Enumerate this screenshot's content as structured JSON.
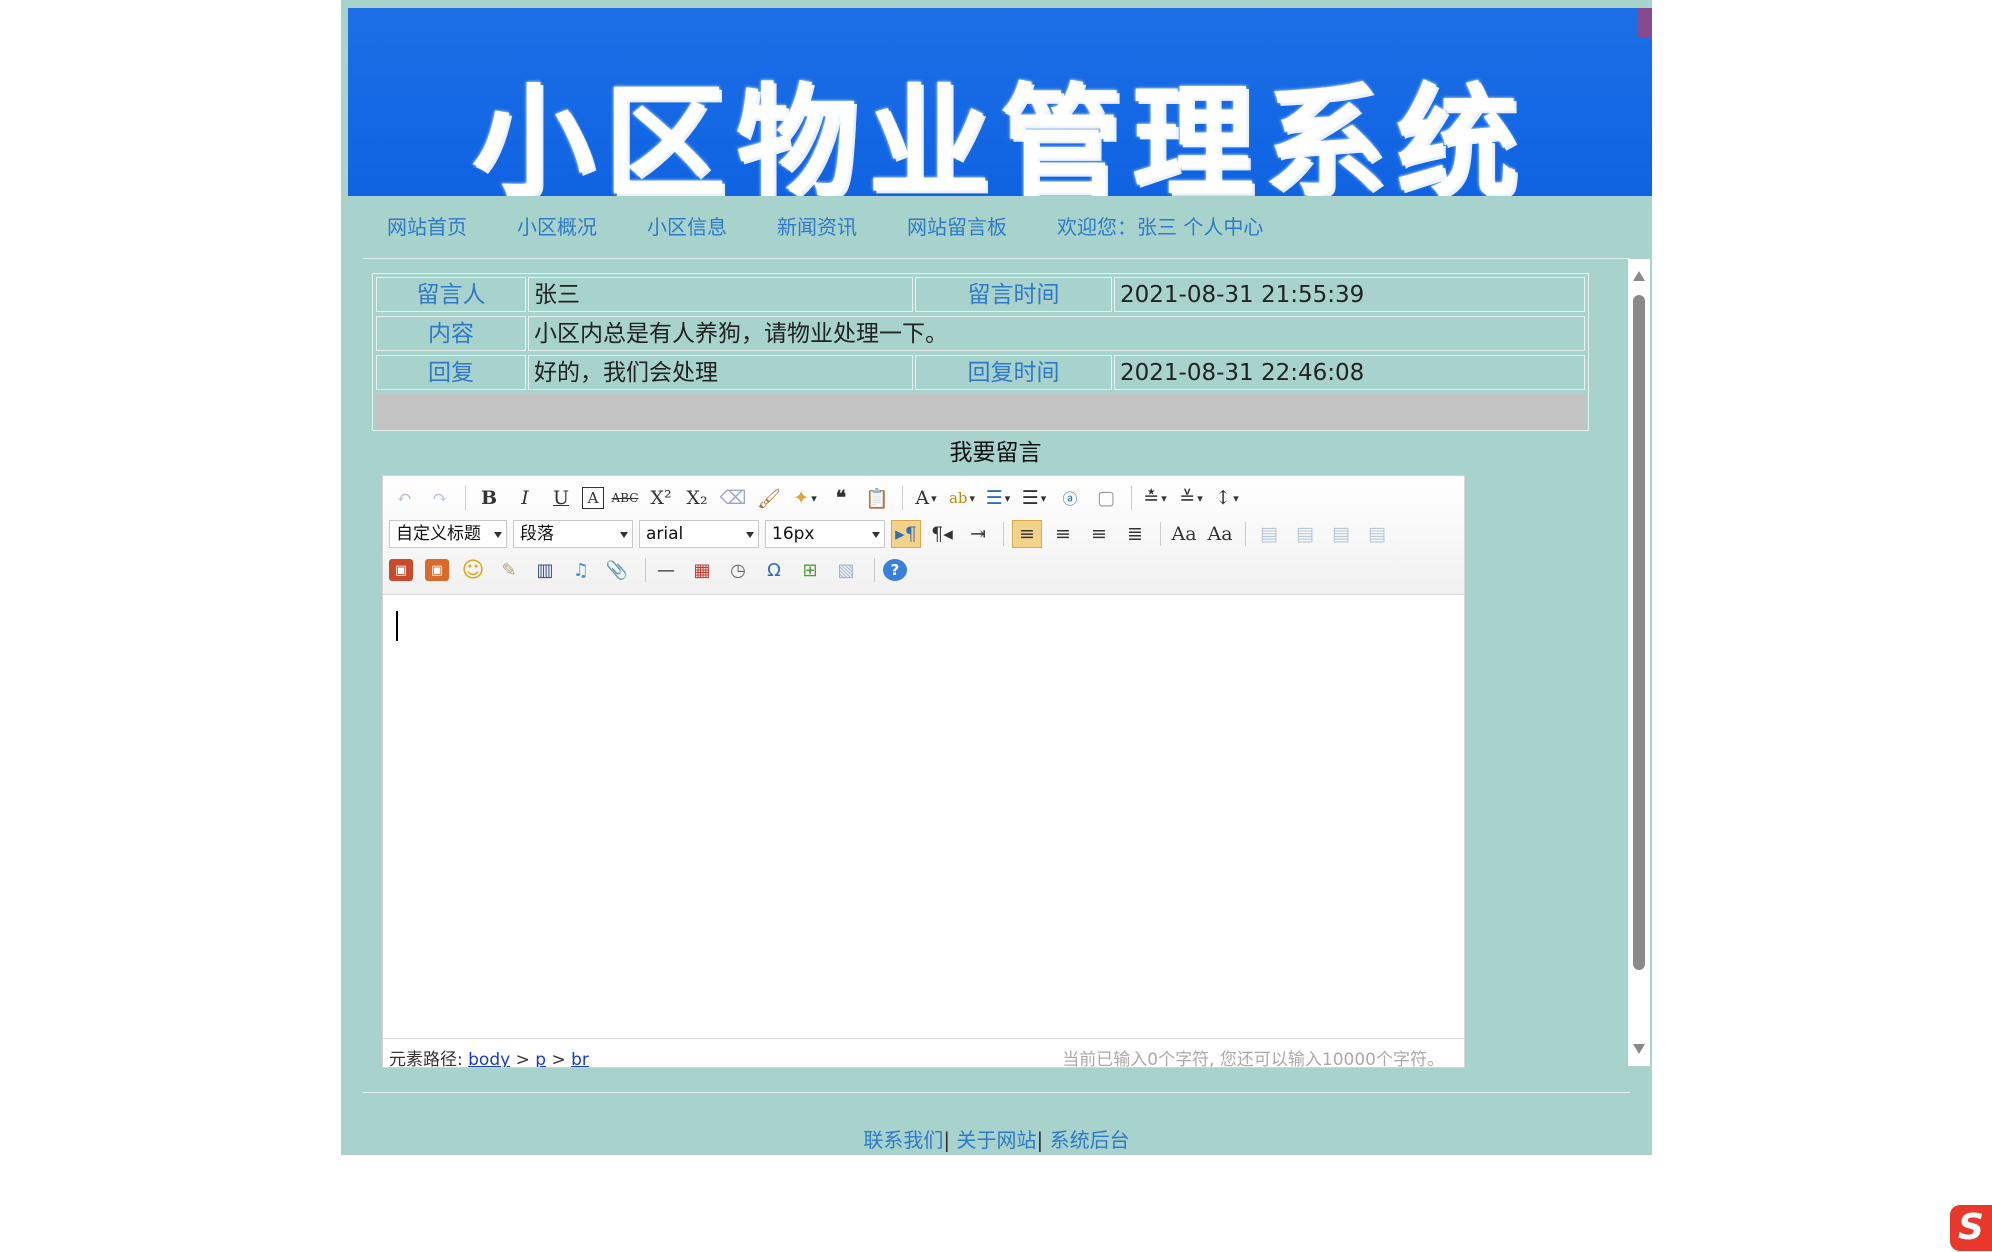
{
  "banner": {
    "title": "小区物业管理系统"
  },
  "nav": {
    "items": [
      "网站首页",
      "小区概况",
      "小区信息",
      "新闻资讯",
      "网站留言板",
      "欢迎您：张三 个人中心"
    ]
  },
  "message": {
    "author_label": "留言人",
    "author": "张三",
    "time_label": "留言时间",
    "time": "2021-08-31 21:55:39",
    "content_label": "内容",
    "content": "小区内总是有人养狗，请物业处理一下。",
    "reply_label": "回复",
    "reply": "好的，我们会处理",
    "reply_time_label": "回复时间",
    "reply_time": "2021-08-31 22:46:08"
  },
  "compose": {
    "title": "我要留言"
  },
  "editor": {
    "heading_select": "自定义标题",
    "paragraph_select": "段落",
    "font_select": "arial",
    "size_select": "16px",
    "path_label": "元素路径:",
    "path_body": "body",
    "path_p": "p",
    "path_br": "br",
    "path_sep": " > ",
    "count_text": "当前已输入0个字符, 您还可以输入10000个字符。"
  },
  "footer": {
    "contact": "联系我们",
    "about": "关于网站",
    "admin": "系统后台",
    "sep": "| "
  },
  "colors": {
    "page_bg": "#a8d3cc",
    "banner_blue": "#0f63e2",
    "link_blue": "#2f7ac8",
    "row_gray": "#c3c3c3"
  }
}
